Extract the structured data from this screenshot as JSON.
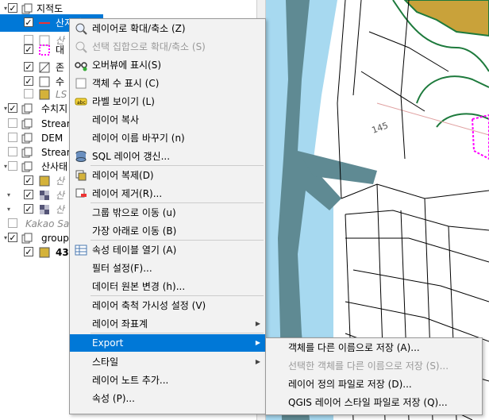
{
  "layer_tree": {
    "rows": [
      {
        "label": "지적도",
        "checked": true,
        "style": "normal",
        "icon": "group-icon"
      },
      {
        "label": "산지정보",
        "checked": true,
        "style": "selected",
        "icon": "line-symbol-icon"
      },
      {
        "label": "산",
        "checked": false,
        "style": "italic",
        "icon": "polygon-icon"
      },
      {
        "label": "대",
        "checked": true,
        "style": "normal",
        "icon": "dashed-polygon-icon"
      },
      {
        "label": "존",
        "checked": true,
        "style": "normal",
        "icon": "diagonal-icon"
      },
      {
        "label": "수",
        "checked": true,
        "style": "normal",
        "icon": "square-icon"
      },
      {
        "label": "LS",
        "checked": false,
        "style": "italic",
        "icon": "yellow-square-icon"
      },
      {
        "label": "수치지",
        "checked": true,
        "style": "normal",
        "icon": "group-icon"
      },
      {
        "label": "Stream",
        "checked": false,
        "style": "normal",
        "icon": "group-icon"
      },
      {
        "label": "DEM",
        "checked": false,
        "style": "normal",
        "icon": "group-icon"
      },
      {
        "label": "Stream",
        "checked": false,
        "style": "normal",
        "icon": "group-icon"
      },
      {
        "label": "산사태",
        "checked": false,
        "style": "normal",
        "icon": "group-icon"
      },
      {
        "label": "산",
        "checked": true,
        "style": "italic",
        "icon": "yellow-square-icon"
      },
      {
        "label": "산",
        "checked": true,
        "style": "italic",
        "icon": "raster-icon"
      },
      {
        "label": "산",
        "checked": true,
        "style": "italic",
        "icon": "raster-icon"
      },
      {
        "label": "Kakao Sa",
        "checked": false,
        "style": "italic",
        "icon": "none"
      },
      {
        "label": "group",
        "checked": true,
        "style": "normal",
        "icon": "group-icon"
      },
      {
        "label": "43",
        "checked": true,
        "style": "bold",
        "icon": "yellow-square-icon"
      }
    ]
  },
  "context_menu": {
    "items": [
      {
        "label": "레이어로 확대/축소 (Z)",
        "icon": "zoom-layer-icon",
        "enabled": true
      },
      {
        "label": "선택 집합으로 확대/축소 (S)",
        "icon": "zoom-selection-icon",
        "enabled": false
      },
      {
        "label": "오버뷰에 표시(S)",
        "icon": "overview-icon",
        "enabled": true
      },
      {
        "label": "객체 수 표시 (C)",
        "icon": "checkbox-icon",
        "enabled": true
      },
      {
        "label": "라벨 보이기 (L)",
        "icon": "label-icon",
        "enabled": true
      },
      {
        "label": "레이어 복사",
        "icon": "",
        "enabled": true
      },
      {
        "label": "레이어 이름 바꾸기 (n)",
        "icon": "",
        "enabled": true
      },
      {
        "label": "SQL 레이어 갱신...",
        "icon": "database-icon",
        "enabled": true
      },
      {
        "label": "레이어 복제(D)",
        "icon": "duplicate-icon",
        "enabled": true
      },
      {
        "label": "레이어 제거(R)...",
        "icon": "remove-layer-icon",
        "enabled": true
      },
      {
        "label": "그룹 밖으로 이동 (u)",
        "icon": "",
        "enabled": true
      },
      {
        "label": "가장 아래로 이동 (B)",
        "icon": "",
        "enabled": true
      },
      {
        "label": "속성 테이블 열기 (A)",
        "icon": "table-icon",
        "enabled": true
      },
      {
        "label": "필터 설정(F)...",
        "icon": "",
        "enabled": true
      },
      {
        "label": "데이터 원본 변경 (h)...",
        "icon": "",
        "enabled": true
      },
      {
        "label": "레이어 축척 가시성 설정 (V)",
        "icon": "",
        "enabled": true
      },
      {
        "label": "레이어 좌표계",
        "icon": "",
        "enabled": true,
        "submenu": true
      },
      {
        "label": "Export",
        "icon": "",
        "enabled": true,
        "submenu": true,
        "highlighted": true
      },
      {
        "label": "스타일",
        "icon": "",
        "enabled": true,
        "submenu": true
      },
      {
        "label": "레이어 노트 추가...",
        "icon": "",
        "enabled": true
      },
      {
        "label": "속성 (P)...",
        "icon": "",
        "enabled": true
      }
    ]
  },
  "export_submenu": {
    "items": [
      {
        "label": "객체를 다른 이름으로 저장 (A)...",
        "enabled": true
      },
      {
        "label": "선택한 객체를 다른 이름으로 저장 (S)...",
        "enabled": false
      },
      {
        "label": "레이어 정의 파일로 저장 (D)...",
        "enabled": true
      },
      {
        "label": "QGIS 레이어 스타일 파일로 저장 (Q)...",
        "enabled": true
      }
    ]
  },
  "map": {
    "labels": {
      "road_label": "145"
    },
    "colors": {
      "river": "#5f8a93",
      "water": "#a7d9f0",
      "forest_fill": "#c9a23a",
      "contour": "#1d7a3c",
      "selection": "#ff00ff"
    }
  }
}
